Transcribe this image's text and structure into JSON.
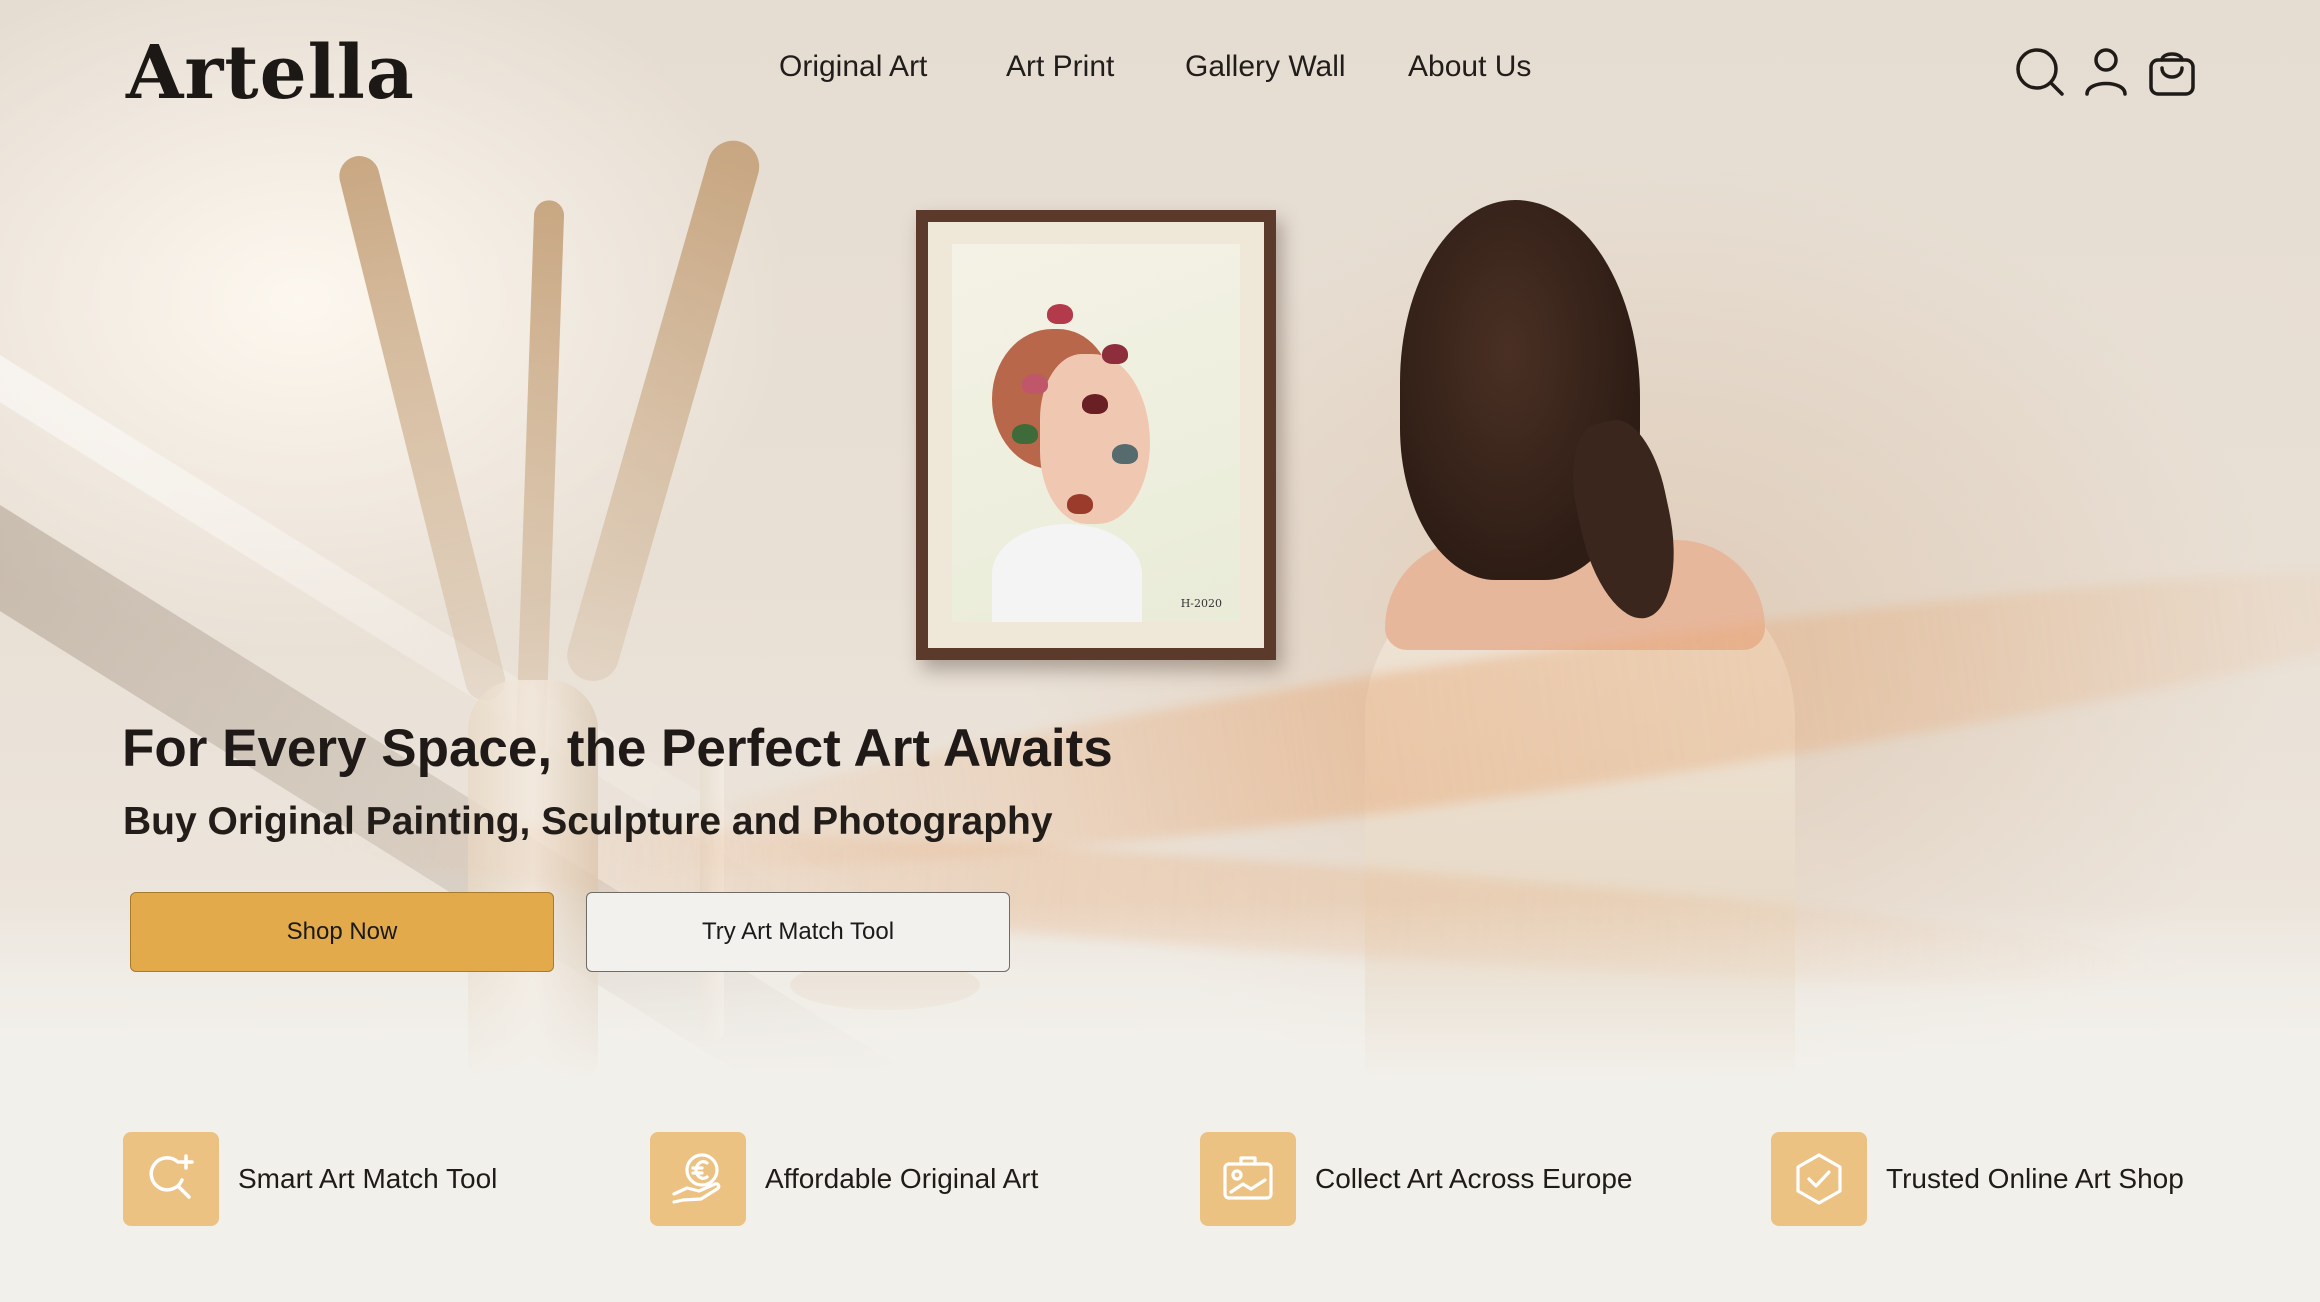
{
  "brand": {
    "logo": "Artella"
  },
  "nav": {
    "items": [
      {
        "label": "Original Art"
      },
      {
        "label": "Art Print"
      },
      {
        "label": "Gallery Wall"
      },
      {
        "label": "About Us"
      }
    ]
  },
  "header_icons": [
    "search-icon",
    "user-icon",
    "shopping-bag-icon"
  ],
  "hero": {
    "headline": "For Every Space, the Perfect Art Awaits",
    "subheadline": "Buy Original Painting, Sculpture and Photography",
    "primary_button": "Shop Now",
    "secondary_button": "Try Art Match Tool",
    "artwork_signature": "H-2020"
  },
  "features": [
    {
      "label": "Smart Art Match Tool",
      "icon": "sparkle-search-icon"
    },
    {
      "label": "Affordable Original Art",
      "icon": "euro-hand-icon"
    },
    {
      "label": "Collect Art Across Europe",
      "icon": "image-card-icon"
    },
    {
      "label": "Trusted Online Art Shop",
      "icon": "verified-shield-icon"
    }
  ],
  "colors": {
    "accent": "#e2aa4b",
    "feature_icon_bg": "#ecc283",
    "text": "#1f1b18",
    "page_bg": "#f2f0eb"
  }
}
